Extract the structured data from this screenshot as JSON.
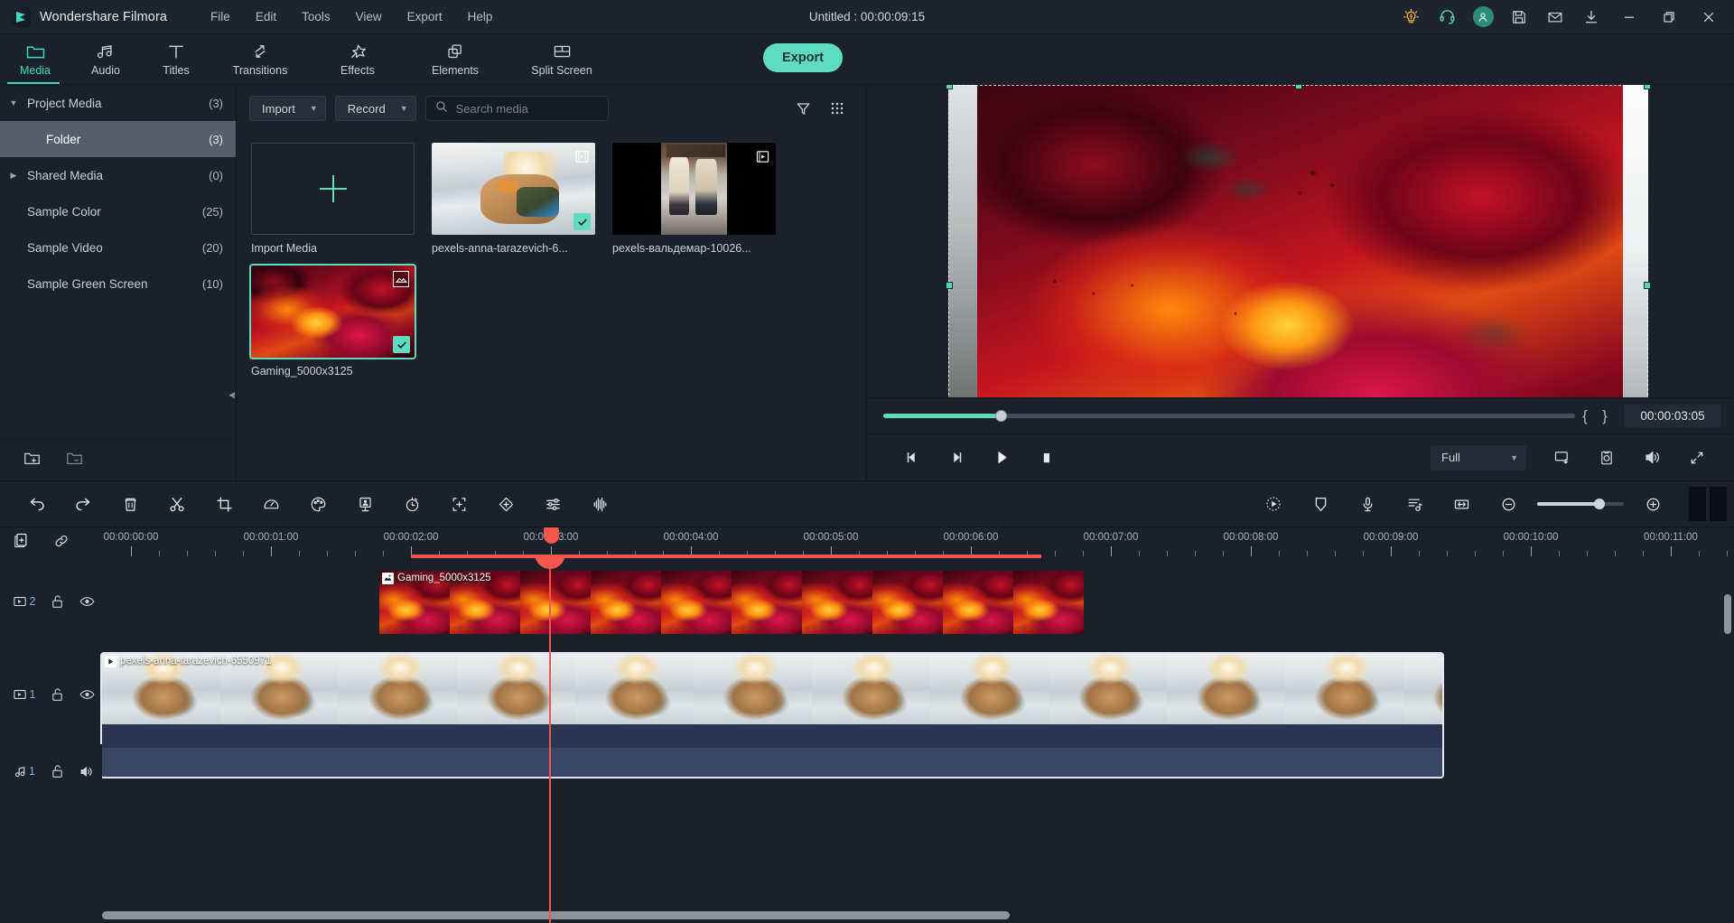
{
  "app": {
    "brand": "Wondershare Filmora",
    "project_title": "Untitled : 00:00:09:15",
    "logo_icon": "filmora-logo-icon"
  },
  "menubar": {
    "items": [
      {
        "label": "File"
      },
      {
        "label": "Edit"
      },
      {
        "label": "Tools"
      },
      {
        "label": "View"
      },
      {
        "label": "Export"
      },
      {
        "label": "Help"
      }
    ]
  },
  "titlebar_actions": [
    {
      "name": "tips-button",
      "icon": "lightbulb-icon",
      "color": "#f0a830"
    },
    {
      "name": "support-button",
      "icon": "headset-icon",
      "color": "#4fd6bb"
    },
    {
      "name": "account-button",
      "icon": "user-avatar-icon",
      "color": "#2c8c78"
    },
    {
      "name": "save-button",
      "icon": "floppy-save-icon",
      "color": "#cbd2da"
    },
    {
      "name": "feedback-button",
      "icon": "mail-icon",
      "color": "#cbd2da"
    },
    {
      "name": "download-button",
      "icon": "download-icon",
      "color": "#cbd2da"
    }
  ],
  "window_controls": [
    {
      "name": "minimize-button",
      "icon": "minimize-icon"
    },
    {
      "name": "maximize-button",
      "icon": "maximize-icon"
    },
    {
      "name": "close-button",
      "icon": "close-icon"
    }
  ],
  "tabs": {
    "active": "Media",
    "accent": "#3ddac0",
    "items": [
      {
        "label": "Media",
        "icon": "folder-icon",
        "active": true
      },
      {
        "label": "Audio",
        "icon": "music-note-icon",
        "active": false
      },
      {
        "label": "Titles",
        "icon": "text-t-icon",
        "active": false
      },
      {
        "label": "Transitions",
        "icon": "transitions-arrows-icon",
        "active": false
      },
      {
        "label": "Effects",
        "icon": "effects-star-icon",
        "active": false
      },
      {
        "label": "Elements",
        "icon": "elements-layers-icon",
        "active": false
      },
      {
        "label": "Split Screen",
        "icon": "split-screen-icon",
        "active": false
      }
    ],
    "export_label": "Export"
  },
  "sidebar": {
    "items": [
      {
        "label": "Project Media",
        "count": "(3)",
        "caret": "▼",
        "indent": false,
        "selected": false
      },
      {
        "label": "Folder",
        "count": "(3)",
        "caret": "",
        "indent": true,
        "selected": true
      },
      {
        "label": "Shared Media",
        "count": "(0)",
        "caret": "▶",
        "indent": false,
        "selected": false
      },
      {
        "label": "Sample Color",
        "count": "(25)",
        "caret": "",
        "indent": false,
        "selected": false
      },
      {
        "label": "Sample Video",
        "count": "(20)",
        "caret": "",
        "indent": false,
        "selected": false
      },
      {
        "label": "Sample Green Screen",
        "count": "(10)",
        "caret": "",
        "indent": false,
        "selected": false
      }
    ],
    "footer": [
      {
        "name": "new-folder-button",
        "icon": "folder-plus-icon"
      },
      {
        "name": "delete-folder-button",
        "icon": "folder-minus-icon"
      }
    ],
    "collapse_icon": "collapse-left-icon"
  },
  "browser": {
    "import_label": "Import",
    "record_label": "Record",
    "search": {
      "placeholder": "Search media",
      "value": ""
    },
    "filter_icon": "filter-funnel-icon",
    "view_icon": "grid-view-icon",
    "items": [
      {
        "label": "Import Media",
        "kind": "import",
        "type_icon": "",
        "checked": false,
        "selected": false
      },
      {
        "label": "pexels-anna-tarazevich-6...",
        "kind": "video",
        "type_icon": "video-frames-icon",
        "checked": true,
        "selected": false
      },
      {
        "label": "pexels-вальдемар-10026...",
        "kind": "video",
        "type_icon": "video-play-icon",
        "checked": false,
        "selected": false
      },
      {
        "label": "Gaming_5000x3125",
        "kind": "image",
        "type_icon": "image-photo-icon",
        "checked": true,
        "selected": true
      }
    ]
  },
  "player": {
    "progress_percent": 17,
    "mark_in_label": "{",
    "mark_out_label": "}",
    "timecode": "00:00:03:05",
    "quality_label": "Full",
    "controls": [
      {
        "name": "prev-frame-button",
        "icon": "step-backward-icon"
      },
      {
        "name": "next-frame-button",
        "icon": "step-forward-icon"
      },
      {
        "name": "play-button",
        "icon": "play-icon"
      },
      {
        "name": "stop-button",
        "icon": "stop-icon"
      }
    ],
    "right_controls": [
      {
        "name": "screen-cast-button",
        "icon": "cast-screen-icon"
      },
      {
        "name": "snapshot-button",
        "icon": "camera-snapshot-icon"
      },
      {
        "name": "volume-button",
        "icon": "speaker-volume-icon"
      },
      {
        "name": "fullscreen-button",
        "icon": "expand-fullscreen-icon"
      }
    ]
  },
  "timeline_toolbar": {
    "left": [
      {
        "name": "undo-button",
        "icon": "undo-arrow-icon"
      },
      {
        "name": "redo-button",
        "icon": "redo-arrow-icon"
      },
      {
        "name": "delete-button",
        "icon": "trash-icon"
      },
      {
        "name": "split-button",
        "icon": "scissors-icon"
      },
      {
        "name": "crop-button",
        "icon": "crop-icon"
      },
      {
        "name": "speed-button",
        "icon": "speedometer-icon"
      },
      {
        "name": "color-button",
        "icon": "color-palette-icon"
      },
      {
        "name": "green-screen-button",
        "icon": "green-screen-icon"
      },
      {
        "name": "duration-button",
        "icon": "stopwatch-icon"
      },
      {
        "name": "auto-reframe-button",
        "icon": "reframe-brackets-icon"
      },
      {
        "name": "keyframe-button",
        "icon": "keyframe-diamond-icon"
      },
      {
        "name": "audio-mixer-button",
        "icon": "mixer-sliders-icon"
      },
      {
        "name": "audio-waveform-button",
        "icon": "audio-waveform-icon"
      }
    ],
    "right": [
      {
        "name": "render-preview-button",
        "icon": "render-preview-icon"
      },
      {
        "name": "marker-button",
        "icon": "marker-shield-icon"
      },
      {
        "name": "voiceover-button",
        "icon": "microphone-icon"
      },
      {
        "name": "auto-beat-sync-button",
        "icon": "beat-sync-icon"
      },
      {
        "name": "fit-timeline-button",
        "icon": "fit-width-icon"
      },
      {
        "name": "zoom-out-button",
        "icon": "minus-circle-icon"
      },
      {
        "name": "zoom-in-button",
        "icon": "plus-circle-icon"
      }
    ],
    "zoom_percent": 72
  },
  "timeline": {
    "head_buttons": [
      {
        "name": "add-track-button",
        "icon": "add-track-icon"
      },
      {
        "name": "link-unlink-button",
        "icon": "link-chain-icon"
      }
    ],
    "ruler_labels": [
      "00:00:00:00",
      "00:00:01:00",
      "00:00:02:00",
      "00:00:03:00",
      "00:00:04:00",
      "00:00:05:00",
      "00:00:06:00",
      "00:00:07:00",
      "00:00:08:00",
      "00:00:09:00",
      "00:00:10:00",
      "00:00:11:00"
    ],
    "playhead_time": "00:00:03:00",
    "split_icon": "scissors-icon",
    "tracks": [
      {
        "name": "video-track-2",
        "type": "video",
        "number": "2",
        "type_icon": "video-track-icon",
        "lock_icon": "unlock-icon",
        "eye_icon": "eye-visible-icon"
      },
      {
        "name": "video-track-1",
        "type": "video",
        "number": "1",
        "type_icon": "video-track-icon",
        "lock_icon": "unlock-icon",
        "eye_icon": "eye-visible-icon"
      },
      {
        "name": "audio-track-1",
        "type": "audio",
        "number": "1",
        "type_icon": "audio-track-icon",
        "lock_icon": "unlock-icon",
        "eye_icon": "speaker-volume-icon"
      }
    ],
    "clips": [
      {
        "name": "clip-gaming",
        "label": "Gaming_5000x3125",
        "track": 2,
        "badge_icon": "image-photo-icon",
        "selected": false
      },
      {
        "name": "clip-pexels-anna",
        "label": "pexels-anna-tarazevich-6550971",
        "track": 1,
        "badge_icon": "video-play-icon",
        "selected": true
      }
    ]
  },
  "colors": {
    "accent": "#5fdcc0",
    "playhead": "#f4564e",
    "panel_bg": "#1b212b",
    "selection": "#555f6c"
  }
}
